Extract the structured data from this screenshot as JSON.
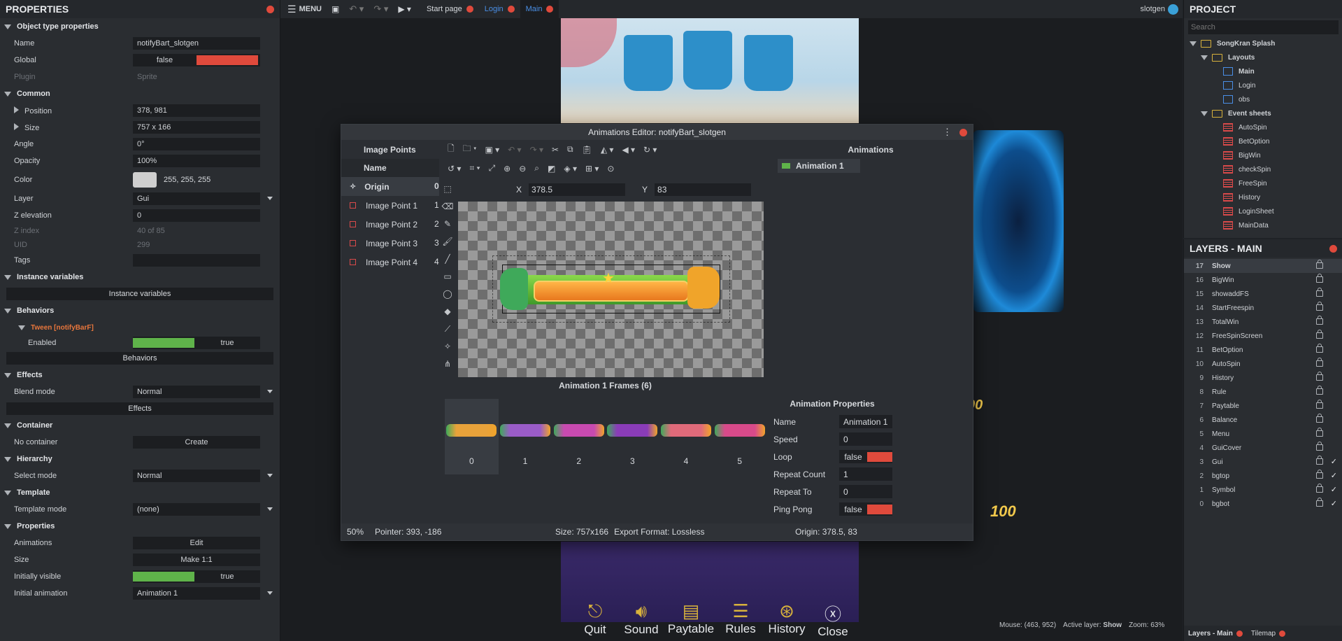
{
  "properties": {
    "title": "PROPERTIES",
    "object_type_header": "Object type properties",
    "name_label": "Name",
    "name_value": "notifyBart_slotgen",
    "global_label": "Global",
    "global_value": "false",
    "plugin_label": "Plugin",
    "plugin_value": "Sprite",
    "common_header": "Common",
    "position_label": "Position",
    "position_value": "378, 981",
    "size_label": "Size",
    "size_value": "757 x 166",
    "angle_label": "Angle",
    "angle_value": "0°",
    "opacity_label": "Opacity",
    "opacity_value": "100%",
    "color_label": "Color",
    "color_value": "255, 255, 255",
    "layer_label": "Layer",
    "layer_value": "Gui",
    "zelev_label": "Z elevation",
    "zelev_value": "0",
    "zindex_label": "Z index",
    "zindex_value": "40 of 85",
    "uid_label": "UID",
    "uid_value": "299",
    "tags_label": "Tags",
    "instvars_header": "Instance variables",
    "instvars_button": "Instance variables",
    "behaviors_header": "Behaviors",
    "tween_label": "Tween [notifyBarF]",
    "enabled_label": "Enabled",
    "enabled_value": "true",
    "behaviors_button": "Behaviors",
    "effects_header": "Effects",
    "blend_label": "Blend mode",
    "blend_value": "Normal",
    "effects_button": "Effects",
    "container_header": "Container",
    "container_label": "No container",
    "container_button": "Create",
    "hierarchy_header": "Hierarchy",
    "select_mode_label": "Select mode",
    "select_mode_value": "Normal",
    "template_header": "Template",
    "template_mode_label": "Template mode",
    "template_mode_value": "(none)",
    "props_header": "Properties",
    "animations_label": "Animations",
    "animations_button": "Edit",
    "psize_label": "Size",
    "psize_button": "Make 1:1",
    "visible_label": "Initially visible",
    "visible_value": "true",
    "initanim_label": "Initial animation",
    "initanim_value": "Animation 1"
  },
  "toolbar": {
    "menu_label": "MENU",
    "tabs": [
      {
        "label": "Start page"
      },
      {
        "label": "Login"
      },
      {
        "label": "Main"
      }
    ],
    "user": "slotgen"
  },
  "project": {
    "title": "PROJECT",
    "search_placeholder": "Search",
    "root": "SongKran Splash",
    "layouts_folder": "Layouts",
    "layouts": [
      "Main",
      "Login",
      "obs"
    ],
    "eventsheets_folder": "Event sheets",
    "eventsheets": [
      "AutoSpin",
      "BetOption",
      "BigWin",
      "checkSpin",
      "FreeSpin",
      "History",
      "LoginSheet",
      "MainData"
    ]
  },
  "layers": {
    "title": "LAYERS - MAIN",
    "items": [
      {
        "num": "17",
        "name": "Show",
        "check": ""
      },
      {
        "num": "16",
        "name": "BigWin",
        "check": ""
      },
      {
        "num": "15",
        "name": "showaddFS",
        "check": ""
      },
      {
        "num": "14",
        "name": "StartFreespin",
        "check": ""
      },
      {
        "num": "13",
        "name": "TotalWin",
        "check": ""
      },
      {
        "num": "12",
        "name": "FreeSpinScreen",
        "check": ""
      },
      {
        "num": "11",
        "name": "BetOption",
        "check": ""
      },
      {
        "num": "10",
        "name": "AutoSpin",
        "check": ""
      },
      {
        "num": "9",
        "name": "History",
        "check": ""
      },
      {
        "num": "8",
        "name": "Rule",
        "check": ""
      },
      {
        "num": "7",
        "name": "Paytable",
        "check": ""
      },
      {
        "num": "6",
        "name": "Balance",
        "check": ""
      },
      {
        "num": "5",
        "name": "Menu",
        "check": ""
      },
      {
        "num": "4",
        "name": "GuiCover",
        "check": ""
      },
      {
        "num": "3",
        "name": "Gui",
        "check": "✓"
      },
      {
        "num": "2",
        "name": "bgtop",
        "check": "✓"
      },
      {
        "num": "1",
        "name": "Symbol",
        "check": "✓"
      },
      {
        "num": "0",
        "name": "bgbot",
        "check": "✓"
      }
    ],
    "bottom_tab1": "Layers - Main",
    "bottom_tab2": "Tilemap"
  },
  "status": {
    "mouse": "Mouse: (463, 952)",
    "active_layer_prefix": "Active layer: ",
    "active_layer": "Show",
    "zoom": "Zoom: 63%"
  },
  "game": {
    "buttons": [
      "Quit",
      "Sound",
      "Paytable",
      "Rules",
      "History",
      "Close"
    ],
    "numbers": [
      "00",
      "100"
    ]
  },
  "anim_editor": {
    "title": "Animations Editor: notifyBart_slotgen",
    "image_points_header": "Image Points",
    "name_col": "Name",
    "points": [
      "Origin",
      "Image Point 1",
      "Image Point 2",
      "Image Point 3",
      "Image Point 4"
    ],
    "point_col2": [
      "0",
      "1",
      "2",
      "3",
      "4"
    ],
    "x_label": "X",
    "x_value": "378.5",
    "y_label": "Y",
    "y_value": "83",
    "animations_header": "Animations",
    "animations": [
      "Animation 1"
    ],
    "frames_header": "Animation 1 Frames (6)",
    "frames": [
      "0",
      "1",
      "2",
      "3",
      "4",
      "5"
    ],
    "frame_colors": [
      "#e8a23a",
      "#9a5cc8",
      "#c84ab0",
      "#8a3cb8",
      "#e06a7a",
      "#d84a8a"
    ],
    "aprops_header": "Animation Properties",
    "aprops": {
      "name_label": "Name",
      "name_value": "Animation 1",
      "speed_label": "Speed",
      "speed_value": "0",
      "loop_label": "Loop",
      "loop_value": "false",
      "repeat_count_label": "Repeat Count",
      "repeat_count_value": "1",
      "repeat_to_label": "Repeat To",
      "repeat_to_value": "0",
      "pingpong_label": "Ping Pong",
      "pingpong_value": "false"
    },
    "status": {
      "zoom": "50%",
      "pointer": "Pointer: 393, -186",
      "size": "Size: 757x166",
      "export": "Export Format: Lossless",
      "origin": "Origin: 378.5, 83"
    }
  },
  "colors": {
    "accent_red": "#e04a3c",
    "true_green": "#5fb34a",
    "tab_active": "#4a8fe6"
  }
}
